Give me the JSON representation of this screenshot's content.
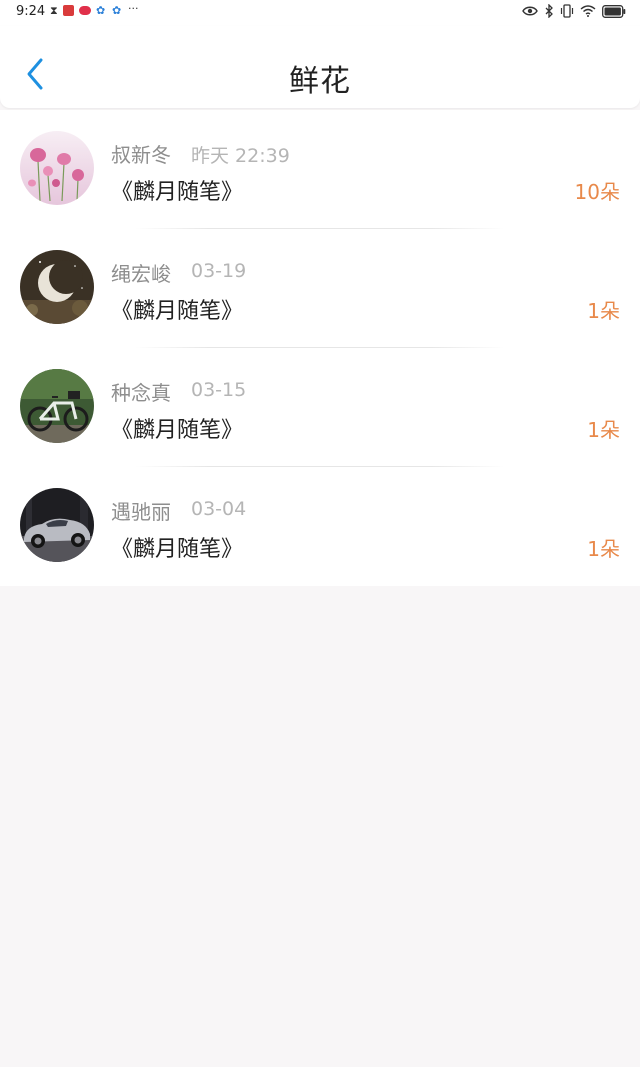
{
  "status_bar": {
    "time": "9:24",
    "dots": "···"
  },
  "header": {
    "title": "鲜花"
  },
  "records": [
    {
      "name": "叔新冬",
      "date": "昨天 22:39",
      "book": "《麟月随笔》",
      "amount": "10朵"
    },
    {
      "name": "绳宏峻",
      "date": "03-19",
      "book": "《麟月随笔》",
      "amount": "1朵"
    },
    {
      "name": "种念真",
      "date": "03-15",
      "book": "《麟月随笔》",
      "amount": "1朵"
    },
    {
      "name": "遇驰丽",
      "date": "03-04",
      "book": "《麟月随笔》",
      "amount": "1朵"
    }
  ],
  "colors": {
    "accent": "#1e90e0",
    "amount": "#e8894a",
    "background": "#f8f6f7"
  }
}
